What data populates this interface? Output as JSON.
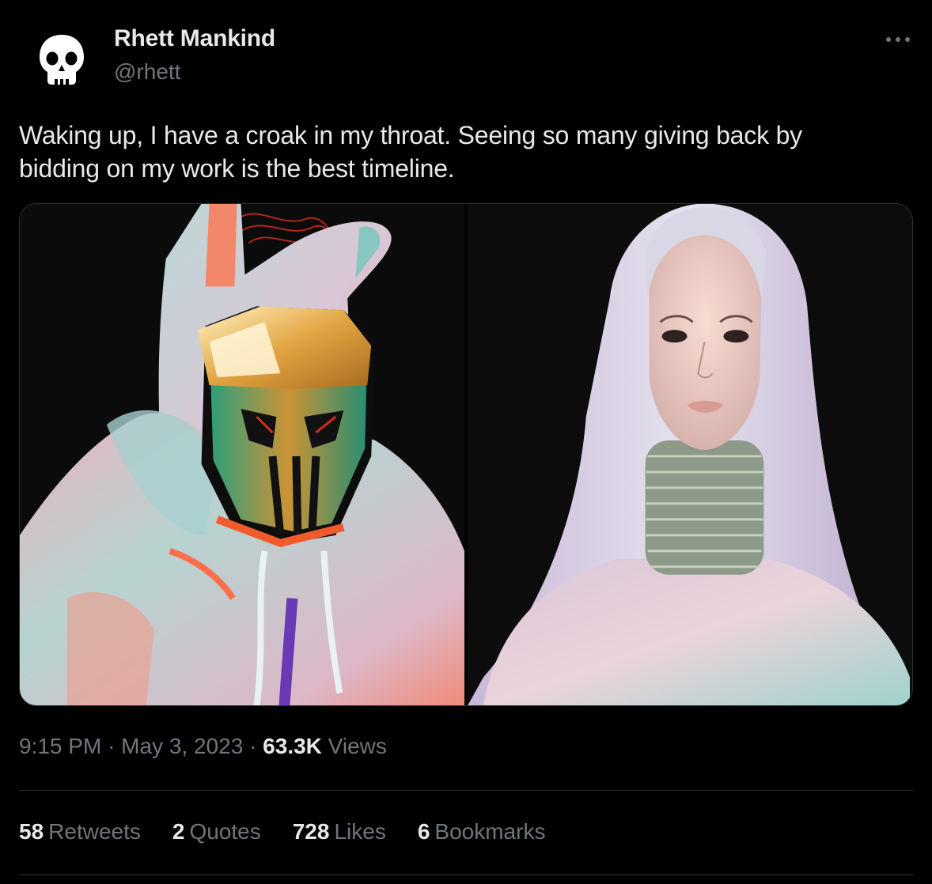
{
  "author": {
    "name": "Rhett Mankind",
    "handle": "@rhett",
    "avatar_icon": "skull-icon"
  },
  "more_icon": "more-horizontal-icon",
  "tweet": {
    "text_line1": "Waking up, I have a croak in my throat. Seeing so many giving back by",
    "text_line2": "bidding on my work is the best timeline."
  },
  "media": [
    {
      "icon": "hooded-masked-figure-artwork"
    },
    {
      "icon": "silver-haired-woman-portrait-artwork"
    }
  ],
  "meta": {
    "time": "9:15 PM",
    "separator": "·",
    "date": "May 3, 2023",
    "views_count": "63.3K",
    "views_label": "Views"
  },
  "stats": {
    "retweets": {
      "count": "58",
      "label": "Retweets"
    },
    "quotes": {
      "count": "2",
      "label": "Quotes"
    },
    "likes": {
      "count": "728",
      "label": "Likes"
    },
    "bookmarks": {
      "count": "6",
      "label": "Bookmarks"
    }
  },
  "colors": {
    "background": "#000000",
    "text_primary": "#e7e9ea",
    "text_secondary": "#71767b",
    "divider": "#2f3336"
  }
}
